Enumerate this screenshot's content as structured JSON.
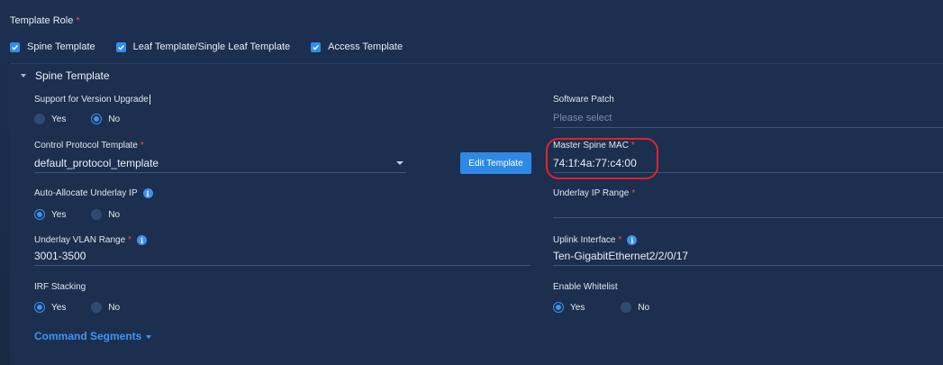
{
  "template_role": {
    "label": "Template Role",
    "required_mark": "*",
    "options": [
      {
        "label": "Spine Template",
        "checked": true
      },
      {
        "label": "Leaf Template/Single Leaf Template",
        "checked": true
      },
      {
        "label": "Access Template",
        "checked": true
      }
    ]
  },
  "panel": {
    "title": "Spine Template",
    "required_mark": "*",
    "support_upgrade": {
      "label": "Support for Version Upgrade",
      "yes": "Yes",
      "no": "No",
      "selected": "No"
    },
    "software_patch": {
      "label": "Software Patch",
      "placeholder": "Please select"
    },
    "control_protocol": {
      "label": "Control Protocol Template",
      "value": "default_protocol_template"
    },
    "edit_button": "Edit Template",
    "master_spine_mac": {
      "label": "Master Spine MAC",
      "value": "74:1f:4a:77:c4:00"
    },
    "auto_allocate": {
      "label": "Auto-Allocate Underlay IP",
      "yes": "Yes",
      "no": "No",
      "selected": "Yes"
    },
    "underlay_ip_range": {
      "label": "Underlay IP Range",
      "value": ""
    },
    "underlay_vlan": {
      "label": "Underlay VLAN Range",
      "value": "3001-3500"
    },
    "uplink_interface": {
      "label": "Uplink Interface",
      "value": "Ten-GigabitEthernet2/2/0/17"
    },
    "irf_stacking": {
      "label": "IRF Stacking",
      "yes": "Yes",
      "no": "No",
      "selected": "Yes"
    },
    "enable_whitelist": {
      "label": "Enable Whitelist",
      "yes": "Yes",
      "no": "No",
      "selected": "Yes"
    },
    "command_segments": "Command Segments"
  },
  "colors": {
    "accent": "#2e89e6",
    "required": "#ef4b4b",
    "highlight": "#e0232a",
    "background": "#1c2f4f"
  },
  "icons": [
    "checkbox-checked-icon",
    "collapse-caret-icon",
    "info-icon",
    "dropdown-arrow-icon",
    "expand-caret-icon"
  ]
}
